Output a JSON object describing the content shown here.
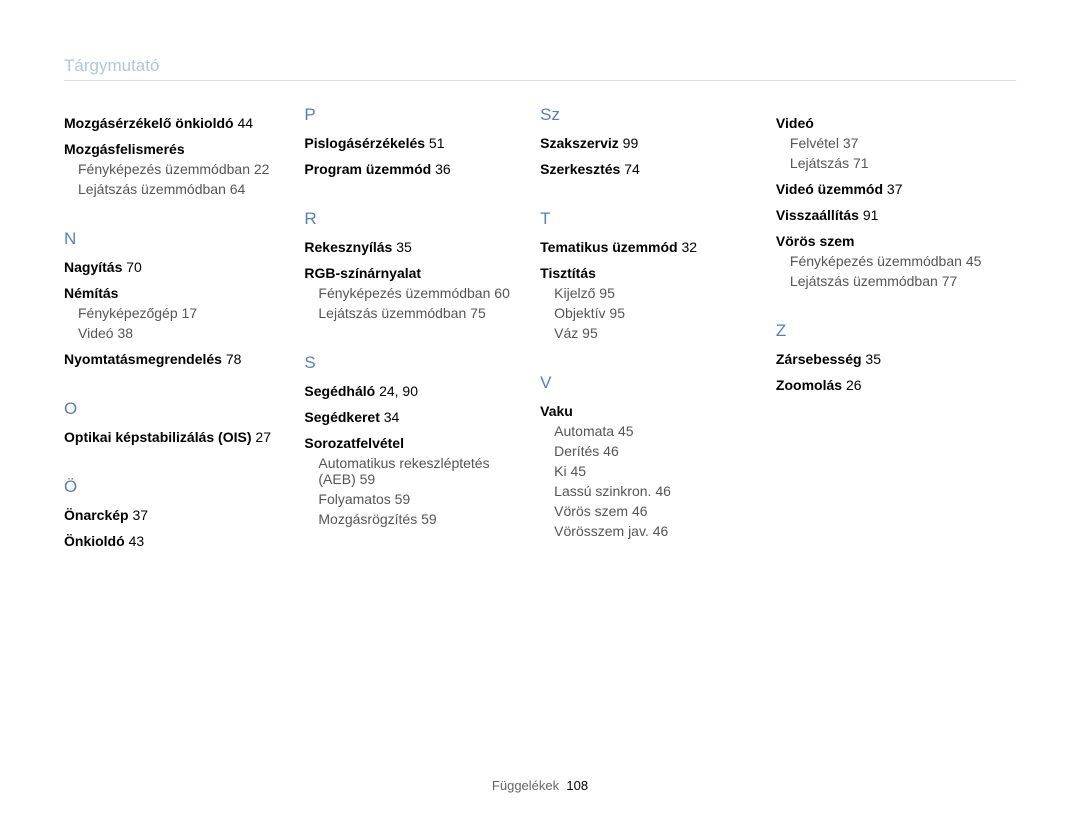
{
  "header": "Tárgymutató",
  "footer": {
    "label": "Függelékek",
    "page": "108"
  },
  "columns": [
    {
      "blocks": [
        {
          "type": "entry",
          "label": "Mozgásérzékelő önkioldó",
          "page": "44",
          "first": true
        },
        {
          "type": "entry",
          "label": "Mozgásfelismerés"
        },
        {
          "type": "sub",
          "label": "Fényképezés üzemmódban",
          "page": "22"
        },
        {
          "type": "sub",
          "label": "Lejátszás üzemmódban",
          "page": "64"
        },
        {
          "type": "letter",
          "label": "N"
        },
        {
          "type": "entry",
          "label": "Nagyítás",
          "page": "70"
        },
        {
          "type": "entry",
          "label": "Némítás"
        },
        {
          "type": "sub",
          "label": "Fényképezőgép",
          "page": "17"
        },
        {
          "type": "sub",
          "label": "Videó",
          "page": "38"
        },
        {
          "type": "entry",
          "label": "Nyomtatásmegrendelés",
          "page": "78"
        },
        {
          "type": "letter",
          "label": "O"
        },
        {
          "type": "entry",
          "label": "Optikai képstabilizálás (OIS)",
          "page": "27"
        },
        {
          "type": "letter",
          "label": "Ö"
        },
        {
          "type": "entry",
          "label": "Önarckép",
          "page": "37"
        },
        {
          "type": "entry",
          "label": "Önkioldó",
          "page": "43"
        }
      ]
    },
    {
      "blocks": [
        {
          "type": "letter",
          "label": "P",
          "first": true
        },
        {
          "type": "entry",
          "label": "Pislogásérzékelés",
          "page": "51"
        },
        {
          "type": "entry",
          "label": "Program üzemmód",
          "page": "36"
        },
        {
          "type": "letter",
          "label": "R"
        },
        {
          "type": "entry",
          "label": "Rekesznyílás",
          "page": "35"
        },
        {
          "type": "entry",
          "label": "RGB-színárnyalat"
        },
        {
          "type": "sub",
          "label": "Fényképezés üzemmódban",
          "page": "60"
        },
        {
          "type": "sub",
          "label": "Lejátszás üzemmódban",
          "page": "75"
        },
        {
          "type": "letter",
          "label": "S"
        },
        {
          "type": "entry",
          "label": "Segédháló",
          "page": "24, 90"
        },
        {
          "type": "entry",
          "label": "Segédkeret",
          "page": "34"
        },
        {
          "type": "entry",
          "label": "Sorozatfelvétel"
        },
        {
          "type": "sub",
          "label": "Automatikus rekeszléptetés (AEB)",
          "page": "59"
        },
        {
          "type": "sub",
          "label": "Folyamatos",
          "page": "59"
        },
        {
          "type": "sub",
          "label": "Mozgásrögzítés",
          "page": "59"
        }
      ]
    },
    {
      "blocks": [
        {
          "type": "letter",
          "label": "Sz",
          "first": true
        },
        {
          "type": "entry",
          "label": "Szakszerviz",
          "page": "99"
        },
        {
          "type": "entry",
          "label": "Szerkesztés",
          "page": "74"
        },
        {
          "type": "letter",
          "label": "T"
        },
        {
          "type": "entry",
          "label": "Tematikus üzemmód",
          "page": "32"
        },
        {
          "type": "entry",
          "label": "Tisztítás"
        },
        {
          "type": "sub",
          "label": "Kijelző",
          "page": "95"
        },
        {
          "type": "sub",
          "label": "Objektív",
          "page": "95"
        },
        {
          "type": "sub",
          "label": "Váz",
          "page": "95"
        },
        {
          "type": "letter",
          "label": "V"
        },
        {
          "type": "entry",
          "label": "Vaku"
        },
        {
          "type": "sub",
          "label": "Automata",
          "page": "45"
        },
        {
          "type": "sub",
          "label": "Derítés",
          "page": "46"
        },
        {
          "type": "sub",
          "label": "Ki",
          "page": "45"
        },
        {
          "type": "sub",
          "label": "Lassú szinkron.",
          "page": "46"
        },
        {
          "type": "sub",
          "label": "Vörös szem",
          "page": "46"
        },
        {
          "type": "sub",
          "label": "Vörösszem jav.",
          "page": "46"
        }
      ]
    },
    {
      "blocks": [
        {
          "type": "entry",
          "label": "Videó",
          "first": true
        },
        {
          "type": "sub",
          "label": "Felvétel",
          "page": "37"
        },
        {
          "type": "sub",
          "label": "Lejátszás",
          "page": "71"
        },
        {
          "type": "entry",
          "label": "Videó üzemmód",
          "page": "37"
        },
        {
          "type": "entry",
          "label": "Visszaállítás",
          "page": "91"
        },
        {
          "type": "entry",
          "label": "Vörös szem"
        },
        {
          "type": "sub",
          "label": "Fényképezés üzemmódban",
          "page": "45"
        },
        {
          "type": "sub",
          "label": "Lejátszás üzemmódban",
          "page": "77"
        },
        {
          "type": "letter",
          "label": "Z"
        },
        {
          "type": "entry",
          "label": "Zársebesség",
          "page": "35"
        },
        {
          "type": "entry",
          "label": "Zoomolás",
          "page": "26"
        }
      ]
    }
  ]
}
